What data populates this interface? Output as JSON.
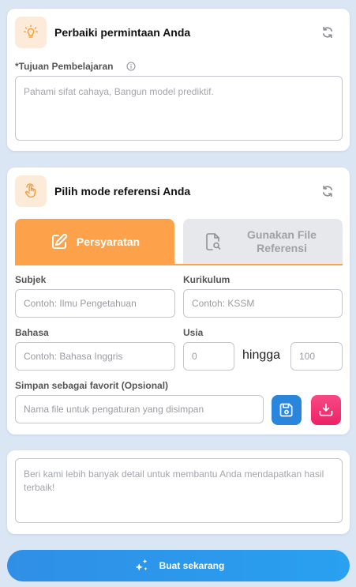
{
  "refine": {
    "title": "Perbaiki permintaan Anda",
    "goal_label": "*Tujuan Pembelajaran",
    "goal_placeholder": "Pahami sifat cahaya, Bangun model prediktif."
  },
  "reference": {
    "title": "Pilih mode referensi Anda",
    "tabs": [
      {
        "label": "Persyaratan",
        "active": true
      },
      {
        "label": "Gunakan File Referensi",
        "active": false
      }
    ],
    "subject_label": "Subjek",
    "subject_placeholder": "Contoh: Ilmu Pengetahuan",
    "curriculum_label": "Kurikulum",
    "curriculum_placeholder": "Contoh: KSSM",
    "language_label": "Bahasa",
    "language_placeholder": "Contoh: Bahasa Inggris",
    "age_label": "Usia",
    "age_from_placeholder": "0",
    "age_to_label": "hingga",
    "age_to_placeholder": "100",
    "favorite_label": "Simpan sebagai favorit (Opsional)",
    "favorite_placeholder": "Nama file untuk pengaturan yang disimpan"
  },
  "details": {
    "placeholder": "Beri kami lebih banyak detail untuk membantu Anda mendapatkan hasil terbaik!"
  },
  "generate": {
    "label": "Buat sekarang"
  },
  "colors": {
    "accent_orange": "#fda24a",
    "badge_bg": "#fdebd9",
    "save_blue": "#2a86dc",
    "pink": "#f2306f",
    "page_bg": "#dbe6f4"
  },
  "icons": {
    "refine": "lightbulb-icon",
    "reference": "hand-tap-icon",
    "refresh": "refresh-icon",
    "info": "info-icon",
    "requirements_tab": "edit-icon",
    "file_tab": "file-search-icon",
    "save": "floppy-disk-icon",
    "load": "download-tray-icon",
    "generate": "sparkles-icon"
  }
}
